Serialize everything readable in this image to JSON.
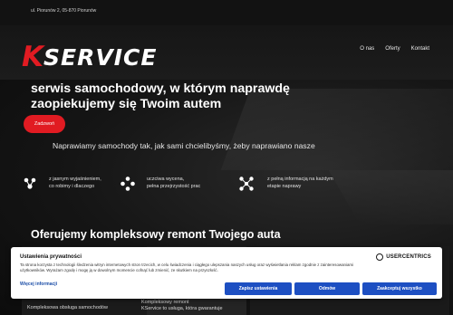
{
  "topbar": {
    "address": "ul. Piorunów 2, 05-870 Piorunów"
  },
  "logo": {
    "k": "K",
    "rest": "SERVICE"
  },
  "nav": {
    "items": [
      "O nas",
      "Oferty",
      "Kontakt"
    ]
  },
  "hero": {
    "headline_line1": "serwis samochodowy, w którym naprawdę",
    "headline_line2": "zaopiekujemy się Twoim autem",
    "cta_label": "Zadzwoń",
    "subline": "Naprawiamy samochody tak, jak sami chcielibyśmy, żeby naprawiano nasze"
  },
  "features": [
    {
      "icon": "people-icon",
      "line1": "z jasnym wyjaśnieniem,",
      "line2": "co robimy i dlaczego"
    },
    {
      "icon": "scale-icon",
      "line1": "uczciwa wycena,",
      "line2": "pełna przejrzystość prac"
    },
    {
      "icon": "network-icon",
      "line1": "z pełną informacją na każdym",
      "line2": "etapie naprawy"
    }
  ],
  "section": {
    "title": "Oferujemy kompleksowy remont Twojego auta",
    "card1_text": "Kompleksowa obsługa samochodów",
    "card2_line1": "Kompleksowy remont",
    "card2_line2": "KService to usługa, która gwarantuje"
  },
  "consent": {
    "title": "Ustawienia prywatności",
    "body": "Ta strona korzysta z technologii śledzenia witryn internetowych stron trzecich, w celu świadczenia i ciągłego ulepszania naszych usług oraz wyświetlania reklam zgodnie z zainteresowaniami użytkowników. Wyrażam zgodę i mogę ją w dowolnym momencie cofnąć lub zmienić, ze skutkiem na przyszłość.",
    "brand": "USERCENTRICS",
    "more_label": "Więcej informacji",
    "settings_label": "Zapisz ustawienia",
    "deny_label": "Odmów",
    "accept_label": "Zaakceptuj wszystko"
  },
  "colors": {
    "brand_red": "#e11b22",
    "consent_button": "#1d4fc2",
    "background": "#0d0d0d"
  }
}
